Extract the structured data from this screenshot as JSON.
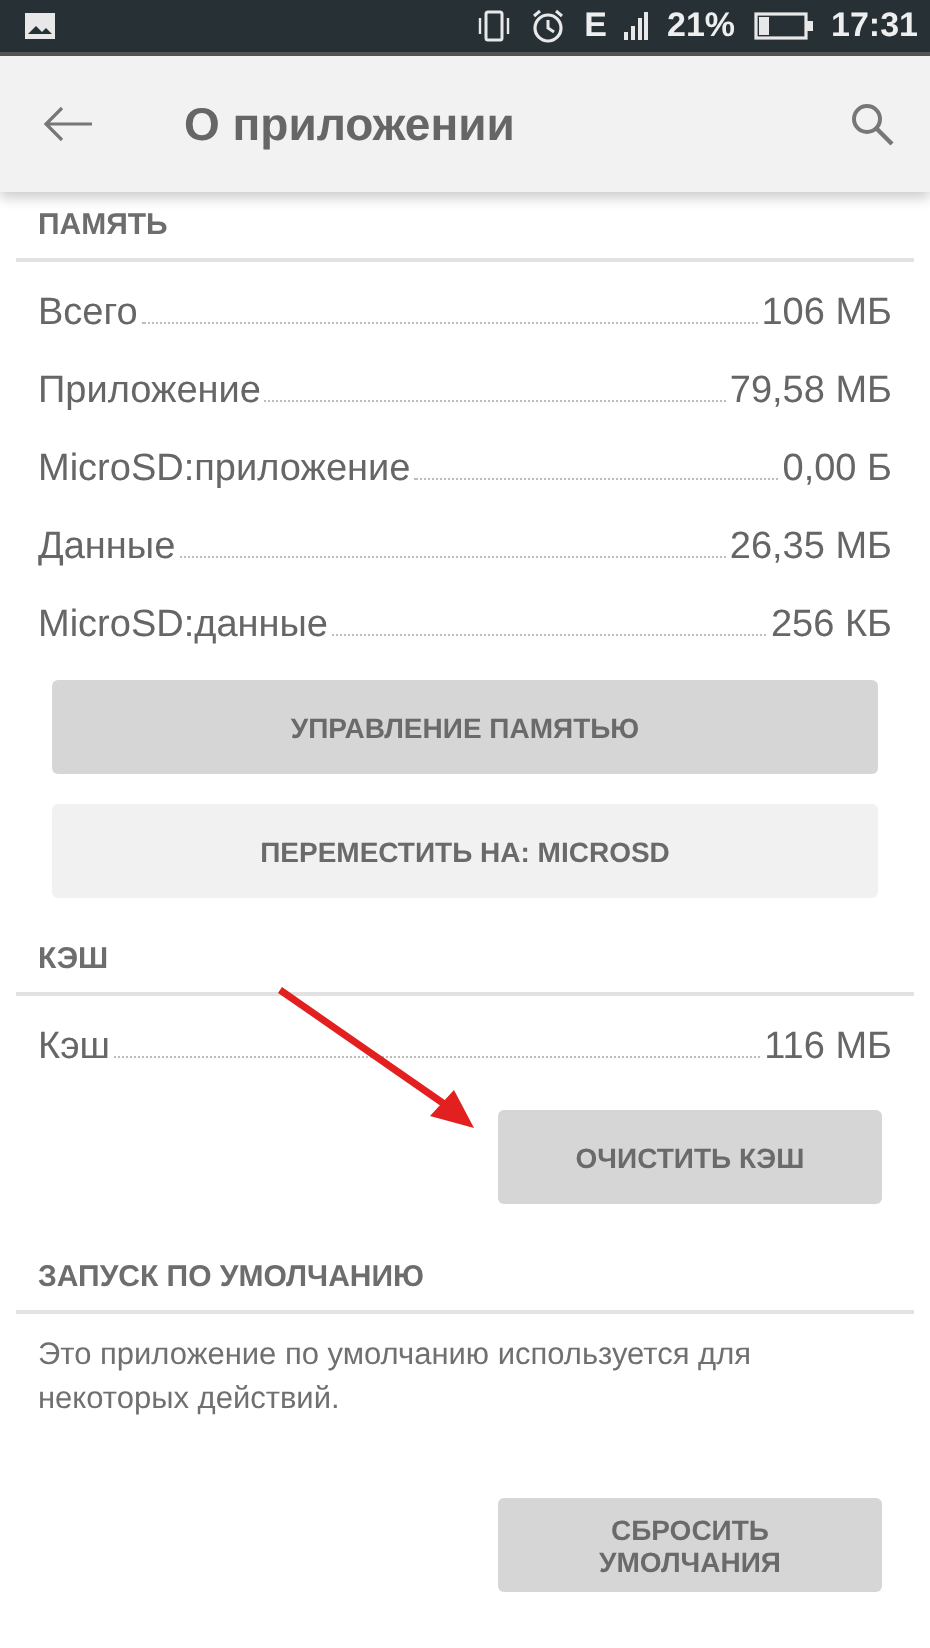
{
  "status_bar": {
    "network": "E",
    "battery": "21%",
    "time": "17:31"
  },
  "toolbar": {
    "title": "О приложении"
  },
  "sections": [
    {
      "header": "ПАМЯТЬ",
      "rows": [
        {
          "label": "Всего",
          "value": "106 МБ"
        },
        {
          "label": "Приложение",
          "value": "79,58 МБ"
        },
        {
          "label": "MicroSD:приложение",
          "value": "0,00 Б"
        },
        {
          "label": "Данные",
          "value": "26,35 МБ"
        },
        {
          "label": "MicroSD:данные",
          "value": "256 КБ"
        }
      ],
      "buttons": [
        {
          "label": "УПРАВЛЕНИЕ ПАМЯТЬЮ",
          "kind": "wide",
          "disabled": false
        },
        {
          "label": "ПЕРЕМЕСТИТЬ НА: MICROSD",
          "kind": "wide",
          "disabled": true
        }
      ]
    },
    {
      "header": "КЭШ",
      "rows": [
        {
          "label": "Кэш",
          "value": "116 МБ"
        }
      ],
      "buttons": [
        {
          "label": "ОЧИСТИТЬ КЭШ",
          "kind": "right",
          "disabled": false
        }
      ]
    },
    {
      "header": "ЗАПУСК ПО УМОЛЧАНИЮ",
      "text": "Это приложение по умолчанию используется для некоторых действий.",
      "buttons": [
        {
          "label": "СБРОСИТЬ УМОЛЧАНИЯ",
          "kind": "right",
          "disabled": false
        }
      ]
    }
  ]
}
